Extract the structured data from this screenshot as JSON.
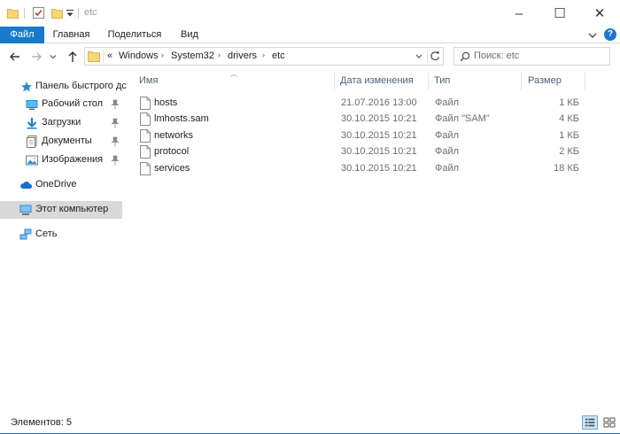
{
  "window": {
    "title": "etc",
    "controls": {
      "minimize": "–",
      "maximize": "☐",
      "close": "✕"
    }
  },
  "ribbon": {
    "tabs": [
      {
        "label": "Файл"
      },
      {
        "label": "Главная"
      },
      {
        "label": "Поделиться"
      },
      {
        "label": "Вид"
      }
    ],
    "help": "?"
  },
  "navigation": {
    "breadcrumb_prefix": "«",
    "breadcrumb": [
      "Windows",
      "System32",
      "drivers",
      "etc"
    ],
    "search_placeholder": "Поиск: etc"
  },
  "sidebar": {
    "items": [
      {
        "label": "Панель быстрого дс",
        "icon": "star-icon",
        "pinned": false
      },
      {
        "label": "Рабочий стол",
        "icon": "desktop-icon",
        "pinned": true
      },
      {
        "label": "Загрузки",
        "icon": "download-icon",
        "pinned": true
      },
      {
        "label": "Документы",
        "icon": "documents-icon",
        "pinned": true
      },
      {
        "label": "Изображения",
        "icon": "pictures-icon",
        "pinned": true
      },
      {
        "label": "OneDrive",
        "icon": "cloud-icon",
        "pinned": false
      },
      {
        "label": "Этот компьютер",
        "icon": "computer-icon",
        "pinned": false,
        "selected": true
      },
      {
        "label": "Сеть",
        "icon": "network-icon",
        "pinned": false
      }
    ]
  },
  "filelist": {
    "columns": {
      "name": "Имя",
      "date": "Дата изменения",
      "type": "Тип",
      "size": "Размер"
    },
    "rows": [
      {
        "name": "hosts",
        "date": "21.07.2016 13:00",
        "type": "Файл",
        "size": "1 КБ"
      },
      {
        "name": "lmhosts.sam",
        "date": "30.10.2015 10:21",
        "type": "Файл \"SAM\"",
        "size": "4 КБ"
      },
      {
        "name": "networks",
        "date": "30.10.2015 10:21",
        "type": "Файл",
        "size": "1 КБ"
      },
      {
        "name": "protocol",
        "date": "30.10.2015 10:21",
        "type": "Файл",
        "size": "2 КБ"
      },
      {
        "name": "services",
        "date": "30.10.2015 10:21",
        "type": "Файл",
        "size": "18 КБ"
      }
    ]
  },
  "status": {
    "items_count": "Элементов: 5"
  },
  "colors": {
    "accent": "#1979ca",
    "folder_yellow": "#f8d775",
    "selected_bg": "#d9d9d9",
    "header_text": "#4c607a",
    "secondary_text": "#6d6d6d"
  }
}
